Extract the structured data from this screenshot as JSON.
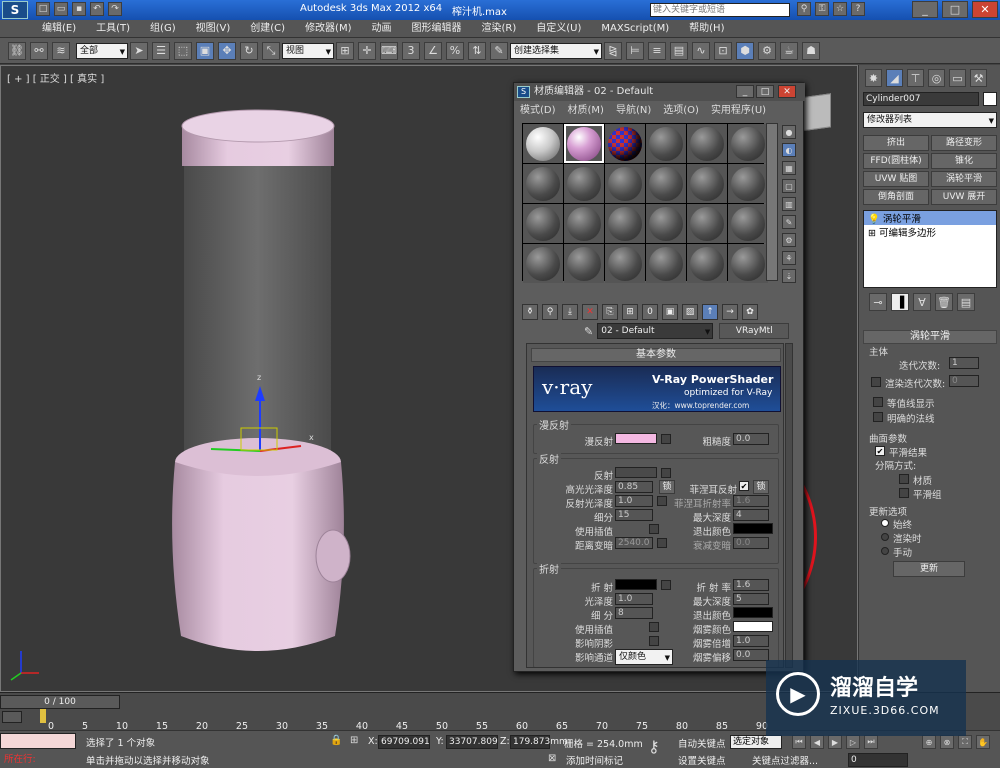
{
  "titlebar": {
    "app_title": "Autodesk 3ds Max  2012 x64",
    "file_name": "榨汁机.max",
    "search_placeholder": "键入关键字或短语"
  },
  "menubar": {
    "items": [
      "编辑(E)",
      "工具(T)",
      "组(G)",
      "视图(V)",
      "创建(C)",
      "修改器(M)",
      "动画",
      "图形编辑器",
      "渲染(R)",
      "自定义(U)",
      "MAXScript(M)",
      "帮助(H)"
    ]
  },
  "toolbar": {
    "selection_filter": "全部",
    "reference_coord": "视图",
    "named_selection": "创建选择集"
  },
  "viewport": {
    "label": "[ + ] [ 正交 ] [ 真实 ]",
    "axis_labels": {
      "x": "x",
      "y": "y",
      "z": "z"
    }
  },
  "material_editor": {
    "title": "材质编辑器 - 02 - Default",
    "menu": [
      "模式(D)",
      "材质(M)",
      "导航(N)",
      "选项(O)",
      "实用程序(U)"
    ],
    "material_name": "02 - Default",
    "material_type": "VRayMtl",
    "rollout_basic": "基本参数",
    "banner": {
      "logo": "v·ray",
      "title": "V-Ray PowerShader",
      "subtitle": "optimized for V-Ray",
      "credit": "汉化：www.toprender.com"
    },
    "diffuse": {
      "group": "漫反射",
      "diffuse_label": "漫反射",
      "diffuse_color": "#f4b8e2",
      "roughness_label": "粗糙度",
      "roughness": "0.0"
    },
    "reflection": {
      "group": "反射",
      "reflect_label": "反射",
      "hilight_gloss_label": "高光光泽度",
      "hilight_gloss": "0.85",
      "lock_label": "锁",
      "fresnel_label": "菲涅耳反射",
      "fresnel_lock_label": "锁",
      "refl_gloss_label": "反射光泽度",
      "refl_gloss": "1.0",
      "fresnel_ior_label": "菲涅耳折射率",
      "fresnel_ior": "1.6",
      "subdivs_label": "细分",
      "subdivs": "15",
      "max_depth_label": "最大深度",
      "max_depth": "4",
      "use_interp_label": "使用插值",
      "exit_color_label": "退出颜色",
      "dim_distance_label": "距离变暗",
      "dim_distance": "2540.0",
      "dim_falloff_label": "衰减变暗",
      "dim_falloff": "0.0"
    },
    "refraction": {
      "group": "折射",
      "refract_label": "折 射",
      "ior_label": "折 射 率",
      "ior": "1.6",
      "gloss_label": "光泽度",
      "gloss": "1.0",
      "max_depth_label": "最大深度",
      "max_depth": "5",
      "subdivs_label": "细 分",
      "subdivs": "8",
      "exit_color_label": "退出颜色",
      "use_interp_label": "使用插值",
      "fog_color_label": "烟雾颜色",
      "affect_shadows_label": "影响阴影",
      "fog_mult_label": "烟雾倍增",
      "fog_mult": "1.0",
      "affect_channels_label": "影响通道",
      "affect_channels_value": "仅颜色",
      "fog_bias_label": "烟雾偏移",
      "fog_bias": "0.0"
    }
  },
  "command_panel": {
    "object_name": "Cylinder007",
    "modifier_list": "修改器列表",
    "buttons": [
      "挤出",
      "路径变形",
      "FFD(圆柱体)",
      "锥化",
      "UVW 贴图",
      "涡轮平滑",
      "倒角剖面",
      "UVW 展开"
    ],
    "stack": [
      "涡轮平滑",
      "可编辑多边形"
    ],
    "rollout_title": "涡轮平滑",
    "main_group": "主体",
    "iterations_label": "迭代次数:",
    "iterations": "1",
    "render_iters_label": "渲染迭代次数:",
    "render_iters": "0",
    "isoline_label": "等值线显示",
    "explicit_normals_label": "明确的法线",
    "surface_group": "曲面参数",
    "smooth_result_label": "平滑结果",
    "separate_label": "分隔方式:",
    "materials_label": "材质",
    "smoothing_groups_label": "平滑组",
    "update_group": "更新选项",
    "always_label": "始终",
    "when_render_label": "渲染时",
    "manual_label": "手动",
    "update_button": "更新"
  },
  "timeline": {
    "frame_counter": "0 / 100",
    "ticks": [
      "0",
      "5",
      "10",
      "15",
      "20",
      "25",
      "30",
      "35",
      "40",
      "45",
      "50",
      "55",
      "60",
      "65",
      "70",
      "75",
      "80",
      "85",
      "90"
    ]
  },
  "status": {
    "current_tag": "所在行:",
    "selection_msg": "选择了 1 个对象",
    "prompt_msg": "单击并拖动以选择并移动对象",
    "x_label": "X:",
    "x_value": "69709.091",
    "y_label": "Y:",
    "y_value": "33707.809",
    "z_label": "Z:",
    "z_value": "179.873mm",
    "grid_label": "栅格 = 254.0mm",
    "add_time_tag": "添加时间标记",
    "auto_key": "自动关键点",
    "selected_obj": "选定对象",
    "set_key": "设置关键点",
    "key_filters": "关键点过滤器...",
    "frame_value": "0"
  },
  "watermark": {
    "name": "溜溜自学",
    "url": "ZIXUE.3D66.COM"
  }
}
